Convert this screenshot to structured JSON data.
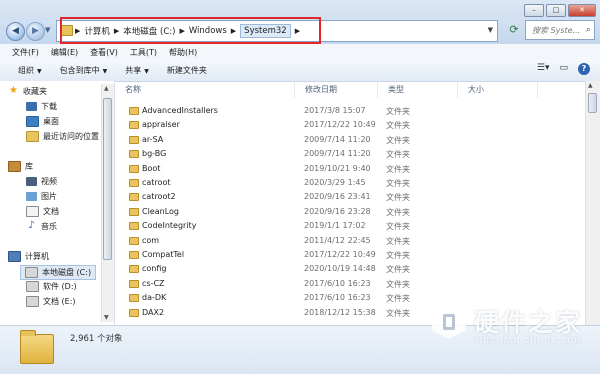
{
  "address": {
    "crumbs": [
      "计算机",
      "本地磁盘 (C:)",
      "Windows",
      "System32"
    ],
    "search_placeholder": "搜索 Syste..."
  },
  "menu": [
    "文件(F)",
    "编辑(E)",
    "查看(V)",
    "工具(T)",
    "帮助(H)"
  ],
  "toolbar": {
    "organize": "组织",
    "include_library": "包含到库中",
    "share": "共享",
    "new_folder": "新建文件夹"
  },
  "nav": {
    "favorites": "收藏夹",
    "downloads": "下载",
    "desktop": "桌面",
    "recent": "最近访问的位置",
    "libraries": "库",
    "videos": "视频",
    "pictures": "图片",
    "documents": "文档",
    "music": "音乐",
    "computer": "计算机",
    "drive_c": "本地磁盘 (C:)",
    "drive_d": "软件 (D:)",
    "drive_e": "文档 (E:)"
  },
  "columns": {
    "name": "名称",
    "date": "修改日期",
    "type": "类型",
    "size": "大小"
  },
  "rows": [
    {
      "name": "AdvancedInstallers",
      "date": "2017/3/8 15:07",
      "type": "文件夹"
    },
    {
      "name": "appraiser",
      "date": "2017/12/22 10:49",
      "type": "文件夹"
    },
    {
      "name": "ar-SA",
      "date": "2009/7/14 11:20",
      "type": "文件夹"
    },
    {
      "name": "bg-BG",
      "date": "2009/7/14 11:20",
      "type": "文件夹"
    },
    {
      "name": "Boot",
      "date": "2019/10/21 9:40",
      "type": "文件夹"
    },
    {
      "name": "catroot",
      "date": "2020/3/29 1:45",
      "type": "文件夹"
    },
    {
      "name": "catroot2",
      "date": "2020/9/16 23:41",
      "type": "文件夹"
    },
    {
      "name": "CleanLog",
      "date": "2020/9/16 23:28",
      "type": "文件夹"
    },
    {
      "name": "CodeIntegrity",
      "date": "2019/1/1 17:02",
      "type": "文件夹"
    },
    {
      "name": "com",
      "date": "2011/4/12 22:45",
      "type": "文件夹"
    },
    {
      "name": "CompatTel",
      "date": "2017/12/22 10:49",
      "type": "文件夹"
    },
    {
      "name": "config",
      "date": "2020/10/19 14:48",
      "type": "文件夹"
    },
    {
      "name": "cs-CZ",
      "date": "2017/6/10 16:23",
      "type": "文件夹"
    },
    {
      "name": "da-DK",
      "date": "2017/6/10 16:23",
      "type": "文件夹"
    },
    {
      "name": "DAX2",
      "date": "2018/12/12 15:38",
      "type": "文件夹"
    }
  ],
  "status": {
    "count": "2,961 个对象"
  },
  "watermark": {
    "text": "硬件之家",
    "pinyin": "YING JIAN ZHI JIA.COM"
  }
}
